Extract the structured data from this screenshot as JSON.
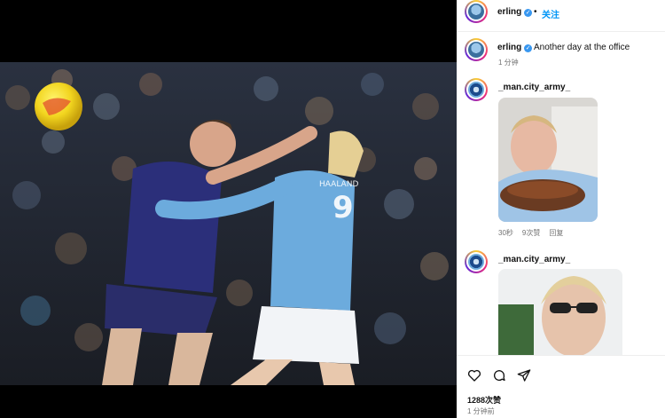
{
  "header": {
    "username": "erling",
    "separator": "•",
    "follow_label": "关注"
  },
  "caption": {
    "username": "erling",
    "text": "Another day at the office",
    "time": "1 分钟"
  },
  "comments": [
    {
      "username": "_man.city_army_",
      "time": "30秒",
      "likes": "9次赞",
      "reply_label": "回复"
    },
    {
      "username": "_man.city_army_"
    }
  ],
  "footer": {
    "likes": "1288次赞",
    "time": "1 分钟前"
  },
  "icons": {
    "verified": "verified-badge-icon",
    "like": "heart-icon",
    "comment": "comment-icon",
    "share": "share-icon"
  },
  "colors": {
    "follow": "#0095f6",
    "verified": "#3897f0",
    "city_blue": "#6cabdd",
    "opponent_navy": "#2b2f7a"
  }
}
